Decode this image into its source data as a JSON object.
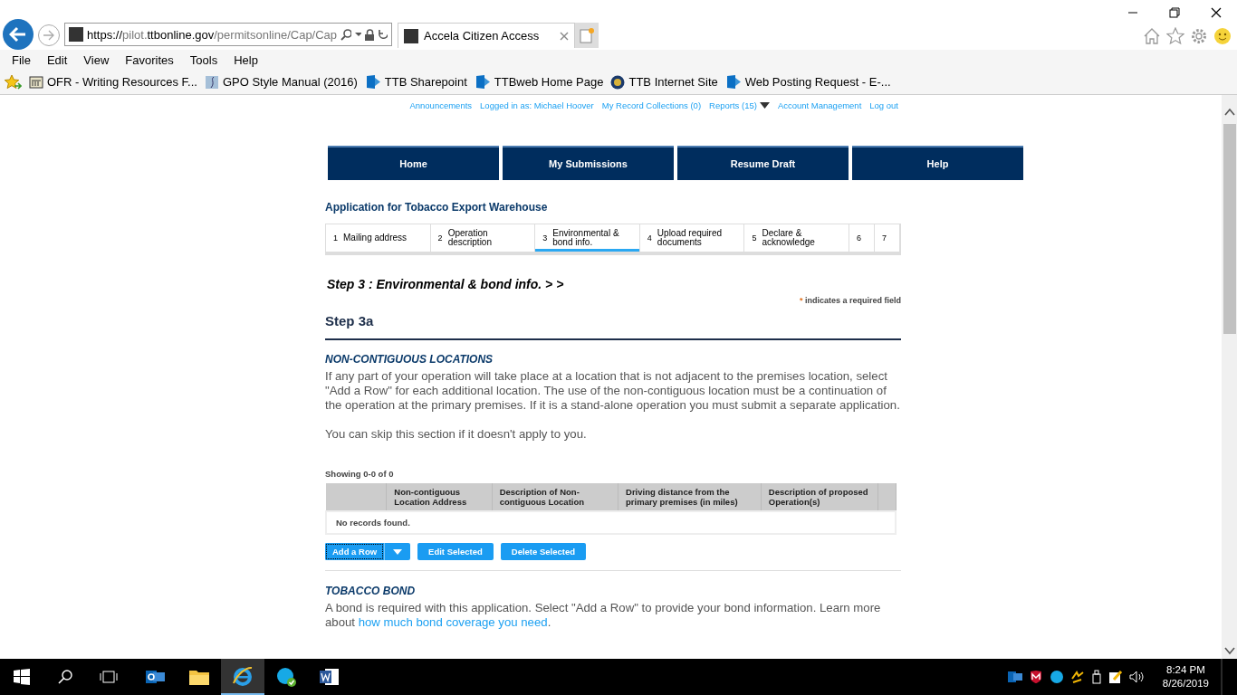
{
  "browser": {
    "address": {
      "scheme": "https://",
      "host_prefix": "pilot.",
      "host": "ttbonline.gov",
      "path": "/permitsonline/Cap/Cap"
    },
    "tabs": [
      {
        "title": "Accela Citizen Access",
        "selected": true
      }
    ],
    "menu": [
      "File",
      "Edit",
      "View",
      "Favorites",
      "Tools",
      "Help"
    ],
    "favorites": [
      {
        "label": "OFR - Writing Resources F...",
        "kind": "page"
      },
      {
        "label": "GPO Style Manual (2016)",
        "kind": "image"
      },
      {
        "label": "TTB Sharepoint",
        "kind": "sharepoint"
      },
      {
        "label": "TTBweb Home Page",
        "kind": "sharepoint"
      },
      {
        "label": "TTB Internet Site",
        "kind": "seal"
      },
      {
        "label": "Web Posting Request - E-...",
        "kind": "sharepoint"
      }
    ]
  },
  "top_links": [
    {
      "label": "Announcements",
      "kind": "link"
    },
    {
      "label": "Logged in as: Michael Hoover",
      "kind": "text"
    },
    {
      "label": "My Record Collections (0)",
      "kind": "link"
    },
    {
      "label": "Reports (15)",
      "kind": "dropdown"
    },
    {
      "label": "Account Management",
      "kind": "link"
    },
    {
      "label": "Log out",
      "kind": "link"
    }
  ],
  "nav": [
    "Home",
    "My Submissions",
    "Resume Draft",
    "Help"
  ],
  "app_title": "Application for Tobacco Export Warehouse",
  "steps": [
    {
      "number": "1",
      "label": "Mailing address",
      "selected": false
    },
    {
      "number": "2",
      "label": "Operation description",
      "selected": false
    },
    {
      "number": "3",
      "label": "Environmental & bond info.",
      "selected": true
    },
    {
      "number": "4",
      "label": "Upload required documents",
      "selected": false
    },
    {
      "number": "5",
      "label": "Declare & acknowledge",
      "selected": false
    },
    {
      "number": "6",
      "selected": false
    },
    {
      "number": "7",
      "selected": false
    }
  ],
  "step_heading": "Step 3 : Environmental & bond info. > >",
  "required_note": {
    "mark": "*",
    "text": "indicates a required field"
  },
  "section_title": "Step 3a",
  "non_contiguous": {
    "title": "NON-CONTIGUOUS LOCATIONS",
    "paragraphs": [
      "If any part of your operation will take place at a location that is not adjacent to the premises location, select \"Add a Row\" for each additional location. The use of the non-contiguous location must be a continuation of the operation at the primary premises. If it is a stand-alone operation you must submit a separate application.",
      "You can skip this section if it doesn't apply to you."
    ],
    "table": {
      "showing": "Showing 0-0 of 0",
      "columns": [
        "Non-contiguous Location Address",
        "Description of Non-contiguous Location",
        "Driving distance from the primary premises (in miles)",
        "Description of proposed Operation(s)"
      ],
      "empty_message": "No records found."
    },
    "buttons": [
      "Add a Row",
      "Edit Selected",
      "Delete Selected"
    ]
  },
  "tobacco_bond": {
    "title": "TOBACCO BOND",
    "text_before": "A bond is required with this application. Select \"Add a Row\" to provide your bond information. Learn more about ",
    "link": "how much bond coverage you need",
    "text_after": "."
  },
  "taskbar": {
    "apps": [
      {
        "kind": "outlook",
        "selected": false
      },
      {
        "kind": "explorer",
        "selected": false
      },
      {
        "kind": "ie",
        "selected": true
      },
      {
        "kind": "skype",
        "selected": false
      },
      {
        "kind": "word",
        "selected": false
      }
    ],
    "time": "8:24 PM",
    "date": "8/26/2019"
  }
}
